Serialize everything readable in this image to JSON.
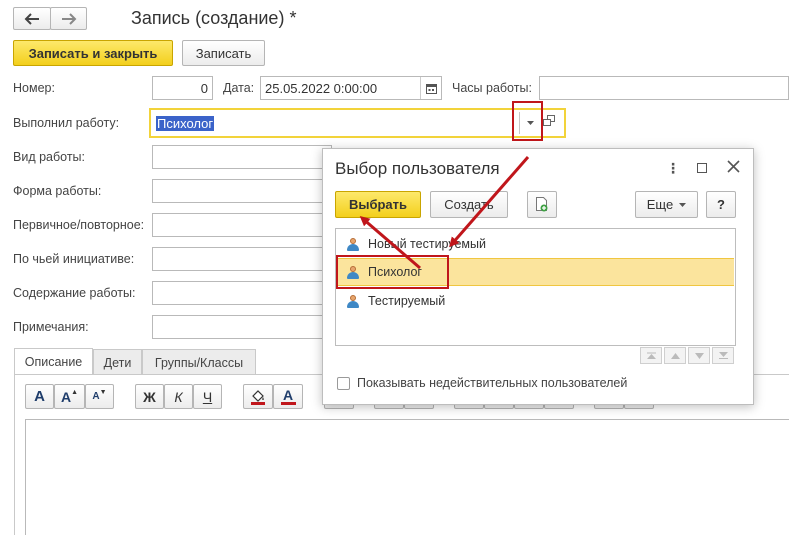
{
  "form": {
    "title": "Запись (создание) *",
    "save_close_label": "Записать и закрыть",
    "save_label": "Записать",
    "fields": {
      "number_label": "Номер:",
      "number_value": "0",
      "date_label": "Дата:",
      "date_value": "25.05.2022  0:00:00",
      "hours_label": "Часы работы:",
      "performer_label": "Выполнил работу:",
      "performer_value": "Психолог",
      "work_type_label": "Вид работы:",
      "work_form_label": "Форма работы:",
      "primary_label": "Первичное/повторное:",
      "initiative_label": "По чьей инициативе:",
      "content_label": "Содержание работы:",
      "notes_label": "Примечания:"
    },
    "tabs": [
      {
        "label": "Описание"
      },
      {
        "label": "Дети"
      },
      {
        "label": "Группы/Классы"
      }
    ],
    "toolbar": {
      "font_large": "A",
      "font_grow": "A",
      "font_shrink": "A",
      "bold": "Ж",
      "italic": "К",
      "underline": "Ч",
      "text_color": "A"
    }
  },
  "dialog": {
    "title": "Выбор пользователя",
    "select_label": "Выбрать",
    "create_label": "Создать",
    "more_label": "Еще",
    "help_label": "?",
    "users": [
      {
        "name": "Новый тестируемый"
      },
      {
        "name": "Психолог"
      },
      {
        "name": "Тестируемый"
      }
    ],
    "show_invalid_label": "Показывать недействительных пользователей"
  },
  "colors": {
    "accent_yellow": "#f6d831",
    "selected_row": "#fbe49d",
    "annotation_red": "#c0161b",
    "selection_blue": "#3b63c9"
  }
}
